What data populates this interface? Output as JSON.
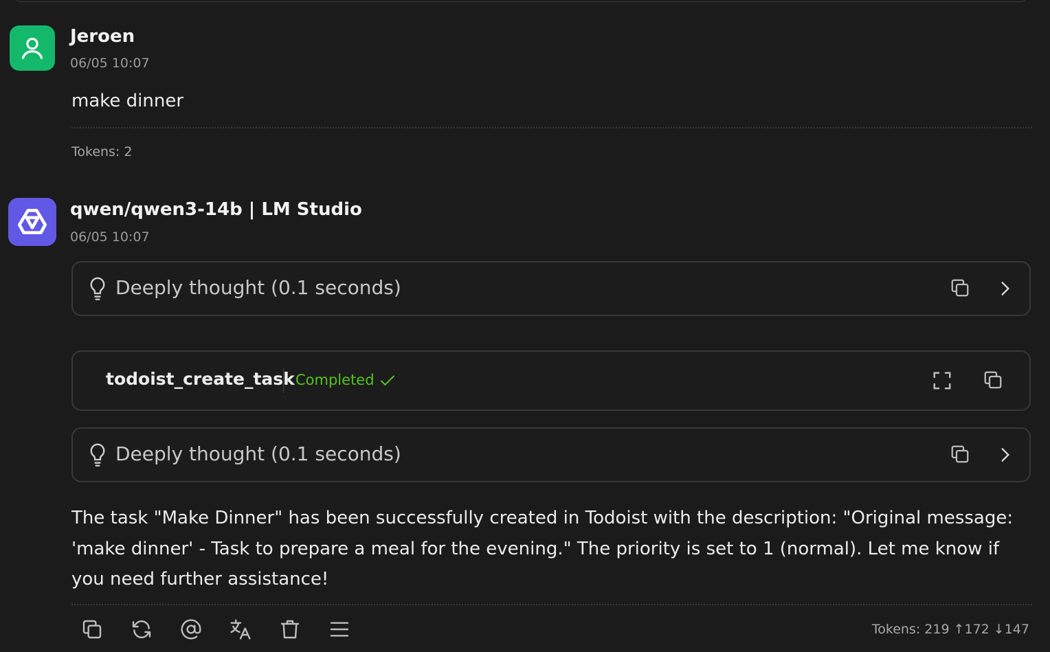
{
  "user_message": {
    "author": "Jeroen",
    "timestamp": "06/05 10:07",
    "text": "make dinner",
    "tokens": "Tokens: 2"
  },
  "assistant_message": {
    "author": "qwen/qwen3-14b | LM Studio",
    "timestamp": "06/05 10:07",
    "thought_1": "Deeply thought (0.1 seconds)",
    "tool_call": {
      "name": "todoist_create_task",
      "status": "Completed"
    },
    "thought_2": "Deeply thought (0.1 seconds)",
    "text": "The task \"Make Dinner\" has been successfully created in Todoist with the description: \"Original message: 'make dinner' - Task to prepare a meal for the evening.\" The priority is set to 1 (normal). Let me know if you need further assistance!",
    "tokens": "Tokens: 219 ↑172 ↓147"
  },
  "colors": {
    "user_avatar": "#14b86b",
    "assistant_avatar": "#6258e6",
    "status_completed": "#52c41a",
    "background": "#1b1b1b"
  },
  "icons": {
    "user_avatar": "user-icon",
    "assistant_avatar": "qwen-logo-icon",
    "thought": "lightbulb-icon",
    "copy": "copy-icon",
    "expand_thought": "chevron-right-icon",
    "fullscreen": "fullscreen-icon",
    "status": "check-icon",
    "toolbar": [
      "copy-icon",
      "refresh-icon",
      "mention-icon",
      "translate-icon",
      "trash-icon",
      "menu-icon"
    ]
  }
}
